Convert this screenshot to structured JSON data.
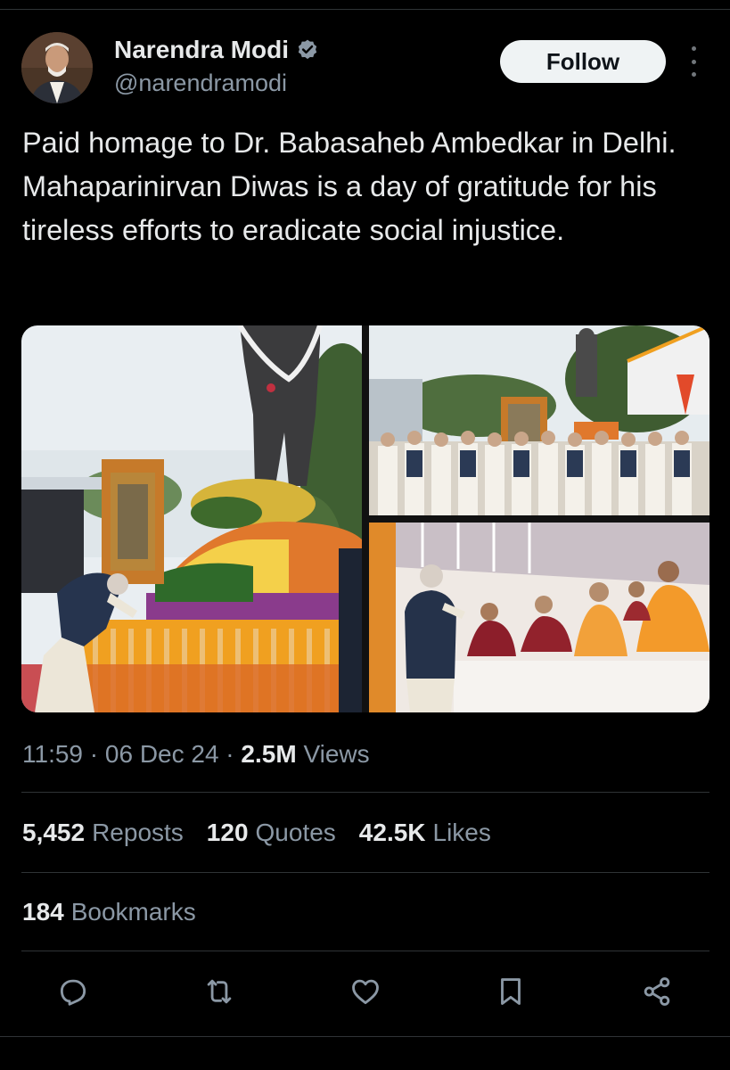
{
  "author": {
    "name": "Narendra Modi",
    "handle": "@narendramodi",
    "verified": true,
    "avatar_icon": "profile-photo"
  },
  "follow_label": "Follow",
  "more_icon": "more-vertical-icon",
  "tweet": {
    "text": "Paid homage to Dr. Babasaheb Ambedkar in Delhi. Mahaparinirvan Diwas is a day of gratitude for his tireless efforts to eradicate social injustice."
  },
  "media": [
    {
      "kind": "photo",
      "subject": "statue-with-flower-garlands"
    },
    {
      "kind": "photo",
      "subject": "group-at-memorial"
    },
    {
      "kind": "photo",
      "subject": "greeting-monks"
    }
  ],
  "meta": {
    "time": "11:59",
    "sep1": " · ",
    "date": "06 Dec 24",
    "sep2": " · ",
    "views_count": "2.5M",
    "views_label": " Views"
  },
  "stats": {
    "reposts_count": "5,452",
    "reposts_label": "Reposts",
    "quotes_count": "120",
    "quotes_label": "Quotes",
    "likes_count": "42.5K",
    "likes_label": "Likes",
    "bookmarks_count": "184",
    "bookmarks_label": "Bookmarks"
  },
  "actions": [
    {
      "name": "reply-icon"
    },
    {
      "name": "repost-icon"
    },
    {
      "name": "like-icon"
    },
    {
      "name": "bookmark-icon"
    },
    {
      "name": "share-icon"
    }
  ],
  "colors": {
    "background": "#000000",
    "text": "#e7e9ea",
    "secondary": "#8b98a5",
    "verified": "#8b98a5",
    "divider": "#2f3336",
    "follow_bg": "#eff3f4"
  }
}
